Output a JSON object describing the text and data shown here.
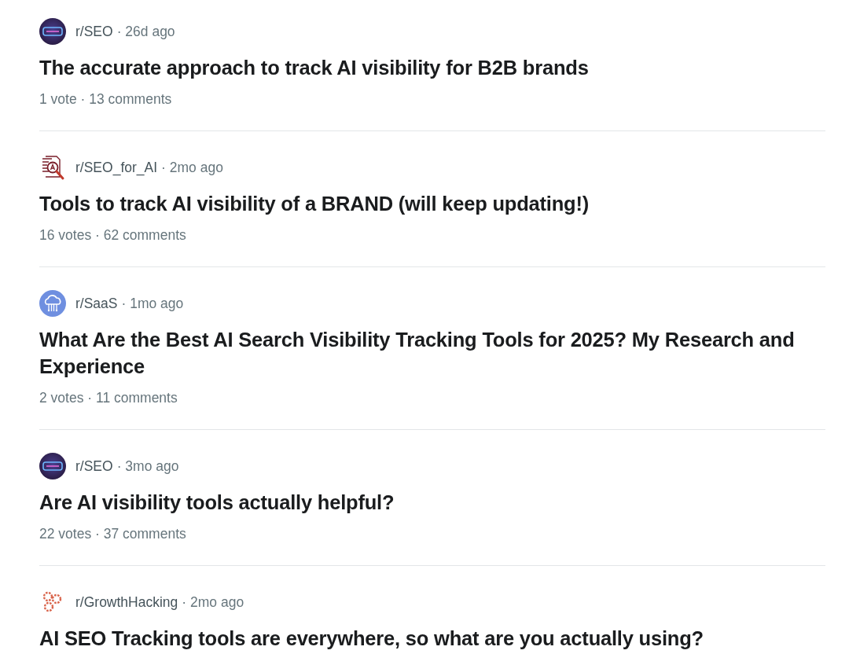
{
  "posts": [
    {
      "icon": {
        "kind": "disc"
      },
      "community": "r/SEO",
      "time": "· 26d ago",
      "title": "The accurate approach to track AI visibility for B2B brands",
      "stats": "1 vote · 13 comments"
    },
    {
      "icon": {
        "kind": "document"
      },
      "community": "r/SEO_for_AI",
      "time": "· 2mo ago",
      "title": "Tools to track AI visibility of a BRAND (will keep updating!)",
      "stats": "16 votes · 62 comments"
    },
    {
      "icon": {
        "kind": "cloud"
      },
      "community": "r/SaaS",
      "time": "· 1mo ago",
      "title": "What Are the Best AI Search Visibility Tracking Tools for 2025? My Research and Experience",
      "stats": "2 votes · 11 comments"
    },
    {
      "icon": {
        "kind": "disc"
      },
      "community": "r/SEO",
      "time": "· 3mo ago",
      "title": "Are AI visibility tools actually helpful?",
      "stats": "22 votes · 37 comments"
    },
    {
      "icon": {
        "kind": "gears"
      },
      "community": "r/GrowthHacking",
      "time": "· 2mo ago",
      "title": "AI SEO Tracking tools are everywhere, so what are you actually using?"
    }
  ]
}
